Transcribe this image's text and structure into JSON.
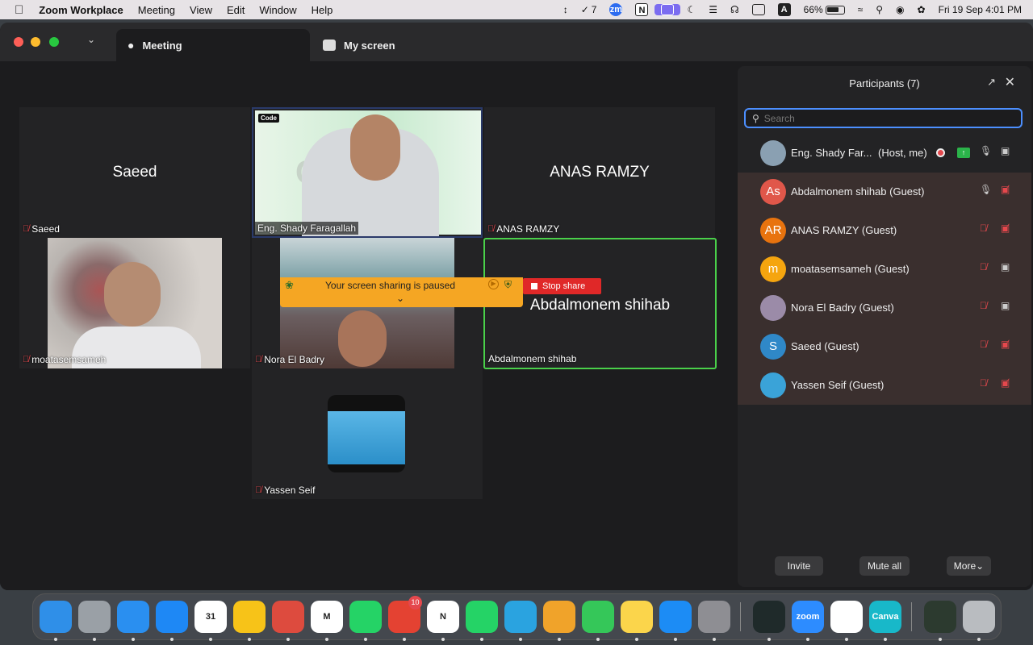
{
  "menubar": {
    "apple_icon": "apple-logo-icon",
    "app_name": "Zoom Workplace",
    "menus": [
      "Meeting",
      "View",
      "Edit",
      "Window",
      "Help"
    ],
    "status_check_count": "7",
    "status_zm": "zm",
    "status_n": "N",
    "status_a": "A",
    "battery": "66%",
    "datetime": "Fri 19 Sep  4:01 PM"
  },
  "window": {
    "tabs": [
      {
        "label": "Meeting",
        "icon": "paw-icon"
      },
      {
        "label": "My screen",
        "icon": "screen-thumb-icon"
      }
    ]
  },
  "stage": {
    "tiles": [
      {
        "big_name": "Saeed",
        "label": "Saeed",
        "muted": true
      },
      {
        "label": "Eng. Shady Faragallah",
        "corner": "Code",
        "muted": false
      },
      {
        "big_name": "ANAS RAMZY",
        "label": "ANAS RAMZY",
        "muted": true
      },
      {
        "label": "moatasemsameh",
        "muted": true
      },
      {
        "label": "Nora El Badry",
        "muted": true
      },
      {
        "big_name": "Abdalmonem shihab",
        "label": "Abdalmonem shihab",
        "muted": false
      },
      {
        "label": "Yassen Seif",
        "muted": true
      }
    ],
    "share_bar": {
      "text": "Your screen sharing is paused",
      "stop_label": "Stop share"
    }
  },
  "participants": {
    "title": "Participants (7)",
    "search_placeholder": "Search",
    "rows": [
      {
        "avatar_text": "",
        "avatar_color": "#8aa0b2",
        "name": "Eng. Shady Far...",
        "role": "(Host, me)",
        "mic_muted": false,
        "cam_off": false
      },
      {
        "avatar_text": "As",
        "avatar_color": "#e0574a",
        "name": "Abdalmonem shihab (Guest)",
        "role": "",
        "mic_muted": false,
        "cam_off": true
      },
      {
        "avatar_text": "AR",
        "avatar_color": "#e8730e",
        "name": "ANAS RAMZY (Guest)",
        "role": "",
        "mic_muted": true,
        "cam_off": true
      },
      {
        "avatar_text": "m",
        "avatar_color": "#f5a50f",
        "name": "moatasemsameh (Guest)",
        "role": "",
        "mic_muted": true,
        "cam_off": false
      },
      {
        "avatar_text": "",
        "avatar_color": "#9b8ba8",
        "name": "Nora El Badry (Guest)",
        "role": "",
        "mic_muted": true,
        "cam_off": false
      },
      {
        "avatar_text": "S",
        "avatar_color": "#2f88c8",
        "name": "Saeed (Guest)",
        "role": "",
        "mic_muted": true,
        "cam_off": true
      },
      {
        "avatar_text": "",
        "avatar_color": "#3aa3d8",
        "name": "Yassen Seif (Guest)",
        "role": "",
        "mic_muted": true,
        "cam_off": true
      }
    ],
    "footer": {
      "invite": "Invite",
      "mute_all": "Mute all",
      "more": "More"
    }
  },
  "dock": {
    "apps": [
      {
        "name": "finder",
        "color": "#2f8fe8",
        "label": ""
      },
      {
        "name": "launchpad",
        "color": "#9aa0a6",
        "label": ""
      },
      {
        "name": "safari",
        "color": "#2a8ff0",
        "label": ""
      },
      {
        "name": "messenger",
        "color": "#1e88f5",
        "label": ""
      },
      {
        "name": "calendar",
        "color": "#ffffff",
        "label": "31"
      },
      {
        "name": "keep",
        "color": "#f7c318",
        "label": ""
      },
      {
        "name": "chrome",
        "color": "#dd4b3e",
        "label": ""
      },
      {
        "name": "gmail",
        "color": "#ffffff",
        "label": "M"
      },
      {
        "name": "whatsapp",
        "color": "#25d366",
        "label": ""
      },
      {
        "name": "todoist",
        "color": "#e44232",
        "label": "",
        "badge": "10"
      },
      {
        "name": "notion",
        "color": "#ffffff",
        "label": "N"
      },
      {
        "name": "whatsapp-business",
        "color": "#25d366",
        "label": ""
      },
      {
        "name": "telegram",
        "color": "#2aa3e0",
        "label": ""
      },
      {
        "name": "photos",
        "color": "#f0a32a",
        "label": ""
      },
      {
        "name": "facetime",
        "color": "#35c759",
        "label": ""
      },
      {
        "name": "notes",
        "color": "#fbd54b",
        "label": ""
      },
      {
        "name": "app-store",
        "color": "#1c8cf5",
        "label": ""
      },
      {
        "name": "system-settings",
        "color": "#8e8e93",
        "label": ""
      },
      {
        "name": "activity-monitor",
        "color": "#1f2a2a",
        "label": ""
      },
      {
        "name": "zoom",
        "color": "#2d8cff",
        "label": "zoom"
      },
      {
        "name": "tasks",
        "color": "#ffffff",
        "label": ""
      },
      {
        "name": "canva",
        "color": "#18b8c9",
        "label": "Canva"
      },
      {
        "name": "disk-utility",
        "color": "#2c3a2f",
        "label": ""
      },
      {
        "name": "trash",
        "color": "#b9bcc0",
        "label": ""
      }
    ]
  }
}
